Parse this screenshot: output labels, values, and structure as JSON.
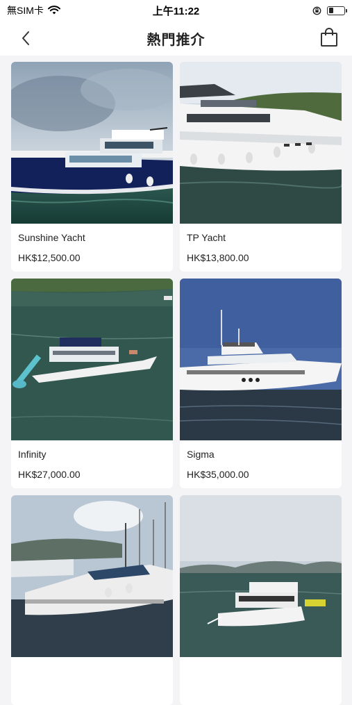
{
  "status": {
    "carrier": "無SIM卡",
    "time": "上午11:22",
    "battery_level": 0.3
  },
  "header": {
    "title": "熱門推介"
  },
  "icons": {
    "back": "chevron-left-icon",
    "cart": "shopping-bag-icon",
    "wifi": "wifi-icon",
    "rotation_lock": "rotation-lock-icon",
    "battery": "battery-icon"
  },
  "products": [
    {
      "name": "Sunshine Yacht",
      "price": "HK$12,500.00",
      "photo": "navy-hull-yacht-photo"
    },
    {
      "name": "TP Yacht",
      "price": "HK$13,800.00",
      "photo": "white-motor-yacht-photo"
    },
    {
      "name": "Infinity",
      "price": "HK$27,000.00",
      "photo": "yacht-with-waterslide-photo"
    },
    {
      "name": "Sigma",
      "price": "HK$35,000.00",
      "photo": "white-flybridge-yacht-photo"
    },
    {
      "name": "",
      "price": "",
      "photo": "marina-sport-yacht-photo"
    },
    {
      "name": "",
      "price": "",
      "photo": "bay-cruiser-photo"
    }
  ]
}
